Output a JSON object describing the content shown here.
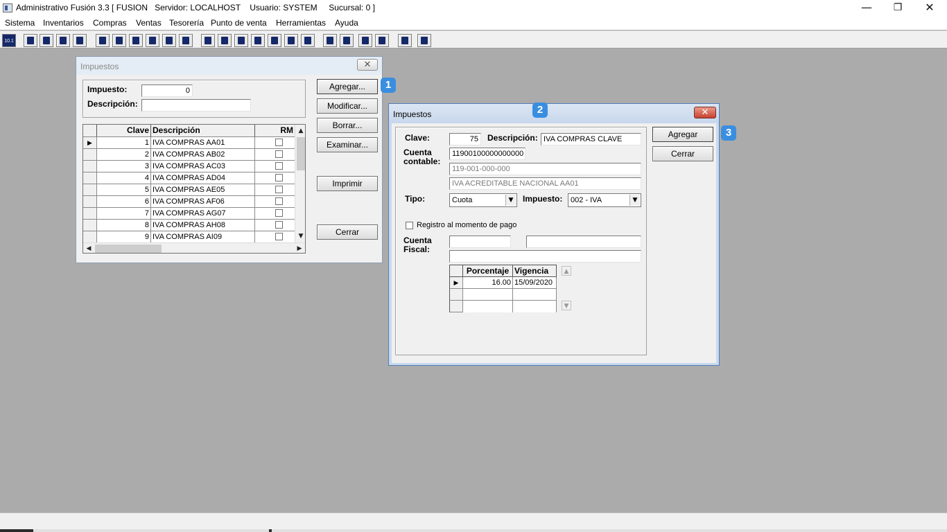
{
  "app": {
    "title": "Administrativo Fusión 3.3 [ FUSION   Servidor: LOCALHOST    Usuario: SYSTEM     Sucursal: 0 ]",
    "minimize": "—",
    "restore": "❐",
    "close": "✕"
  },
  "menu": [
    "Sistema",
    "Inventarios",
    "Compras",
    "Ventas",
    "Tesorería",
    "Punto de venta",
    "Herramientas",
    "Ayuda"
  ],
  "toolbar_first_label": "10.1",
  "list_window": {
    "title": "Impuestos",
    "close": "✕",
    "impuesto_label": "Impuesto:",
    "impuesto_value": "0",
    "descripcion_label": "Descripción:",
    "descripcion_value": "",
    "buttons": {
      "agregar": "Agregar...",
      "modificar": "Modificar...",
      "borrar": "Borrar...",
      "examinar": "Examinar...",
      "imprimir": "Imprimir",
      "cerrar": "Cerrar"
    },
    "grid": {
      "columns": [
        "Clave",
        "Descripción",
        "RM"
      ],
      "rows": [
        {
          "clave": "1",
          "descripcion": "IVA COMPRAS AA01"
        },
        {
          "clave": "2",
          "descripcion": "IVA COMPRAS AB02"
        },
        {
          "clave": "3",
          "descripcion": "IVA COMPRAS AC03"
        },
        {
          "clave": "4",
          "descripcion": "IVA COMPRAS AD04"
        },
        {
          "clave": "5",
          "descripcion": "IVA COMPRAS AE05"
        },
        {
          "clave": "6",
          "descripcion": "IVA COMPRAS AF06"
        },
        {
          "clave": "7",
          "descripcion": "IVA COMPRAS AG07"
        },
        {
          "clave": "8",
          "descripcion": "IVA COMPRAS AH08"
        },
        {
          "clave": "9",
          "descripcion": "IVA COMPRAS AI09"
        }
      ],
      "current_marker": "▶"
    }
  },
  "edit_window": {
    "title": "Impuestos",
    "close": "✕",
    "clave_label": "Clave:",
    "clave_value": "75",
    "descripcion_label": "Descripción:",
    "descripcion_value": "IVA COMPRAS CLAVE",
    "cuenta_label_1": "Cuenta",
    "cuenta_label_2": "contable:",
    "cuenta_value": "11900100000000000",
    "cuenta_formatted": "119-001-000-000",
    "cuenta_nombre": "IVA ACREDITABLE NACIONAL  AA01",
    "tipo_label": "Tipo:",
    "tipo_value": "Cuota",
    "impuesto_label": "Impuesto:",
    "impuesto_value": "002 - IVA",
    "registro_label": "Registro al momento de pago",
    "registro_checked": false,
    "fiscal_label_1": "Cuenta",
    "fiscal_label_2": "Fiscal:",
    "grid": {
      "columns": [
        "Porcentaje",
        "Vigencia"
      ],
      "rows": [
        {
          "porcentaje": "16.00",
          "vigencia": "15/09/2020"
        }
      ],
      "current_marker": "▶"
    },
    "buttons": {
      "agregar": "Agregar",
      "cerrar": "Cerrar"
    }
  },
  "badges": [
    "1",
    "2",
    "3"
  ],
  "colors": {
    "desktop": "#ababab",
    "badge": "#3a8ee0",
    "close_active": "#c74230"
  }
}
